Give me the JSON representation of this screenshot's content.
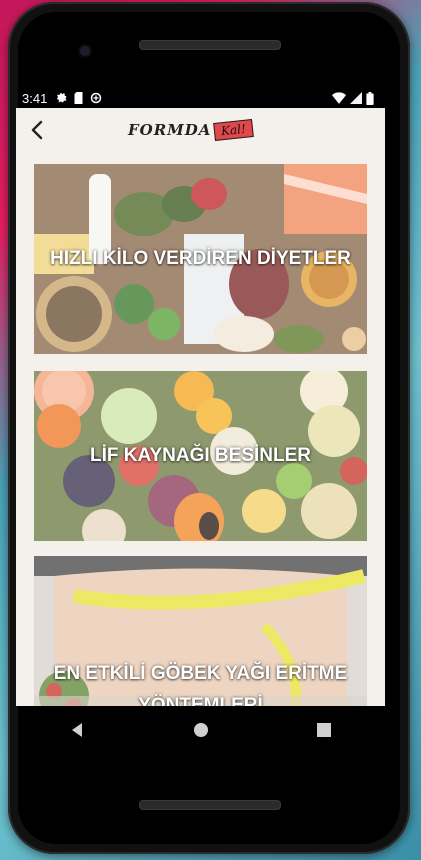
{
  "status_bar": {
    "time": "3:41",
    "left_icons": [
      "gear-icon",
      "sd-card-icon",
      "data-saver-icon"
    ],
    "right_icons": [
      "wifi-icon",
      "signal-icon",
      "battery-icon"
    ]
  },
  "app_bar": {
    "back_icon": "chevron-left-icon",
    "logo_main": "FORMDA",
    "logo_sub": "Kal!"
  },
  "cards": [
    {
      "title": "HIZLI KİLO VERDİREN DİYETLER",
      "image": "assorted healthy foods"
    },
    {
      "title": "LİF KAYNAĞI BESİNLER",
      "image": "fruits and grains"
    },
    {
      "title": "EN ETKİLİ GÖBEK YAĞI ERİTME YÖNTEMLERİ",
      "image": "waist measuring tape"
    }
  ],
  "nav_bar": {
    "buttons": [
      "back-triangle-icon",
      "home-circle-icon",
      "recents-square-icon"
    ]
  },
  "colors": {
    "screen_bg": "#f4f1ec",
    "logo_accent": "#e2474a",
    "phone_body": "#111111"
  }
}
